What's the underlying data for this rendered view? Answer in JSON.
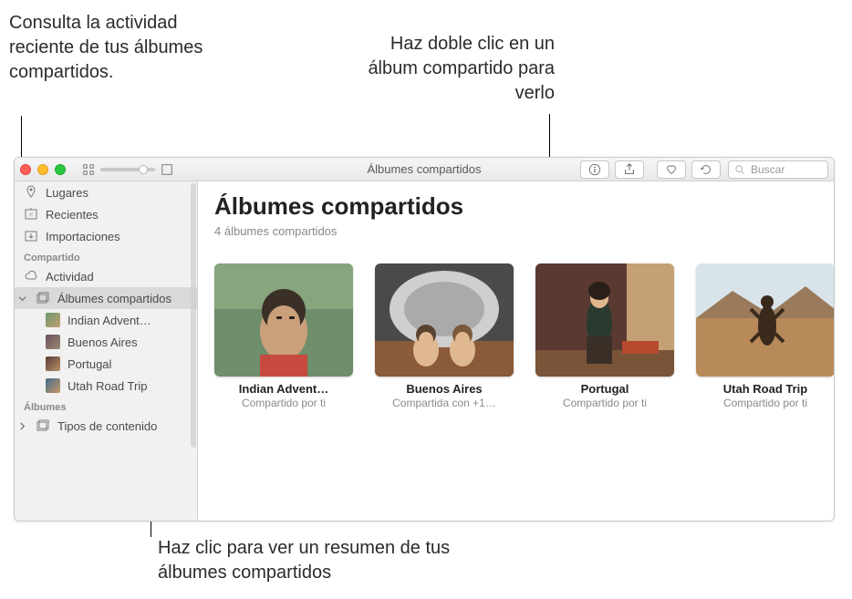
{
  "callouts": {
    "topleft": "Consulta la actividad reciente de tus álbumes compartidos.",
    "topright": "Haz doble clic en un álbum compartido para verlo",
    "bottom": "Haz clic para ver un resumen de tus álbumes compartidos"
  },
  "titlebar": {
    "title": "Álbumes compartidos",
    "search_placeholder": "Buscar"
  },
  "sidebar": {
    "nav": {
      "places": "Lugares",
      "recent": "Recientes",
      "imports": "Importaciones"
    },
    "shared_header": "Compartido",
    "activity": "Actividad",
    "shared_albums": "Álbumes compartidos",
    "shared_items": [
      "Indian Advent…",
      "Buenos Aires",
      "Portugal",
      "Utah Road Trip"
    ],
    "albums_header": "Álbumes",
    "content_types": "Tipos de contenido"
  },
  "main": {
    "heading": "Álbumes compartidos",
    "subtitle": "4 álbumes compartidos",
    "albums": [
      {
        "title": "Indian Advent…",
        "sub": "Compartido por ti"
      },
      {
        "title": "Buenos Aires",
        "sub": "Compartida con +1…"
      },
      {
        "title": "Portugal",
        "sub": "Compartido por ti"
      },
      {
        "title": "Utah Road Trip",
        "sub": "Compartido por ti"
      }
    ]
  }
}
